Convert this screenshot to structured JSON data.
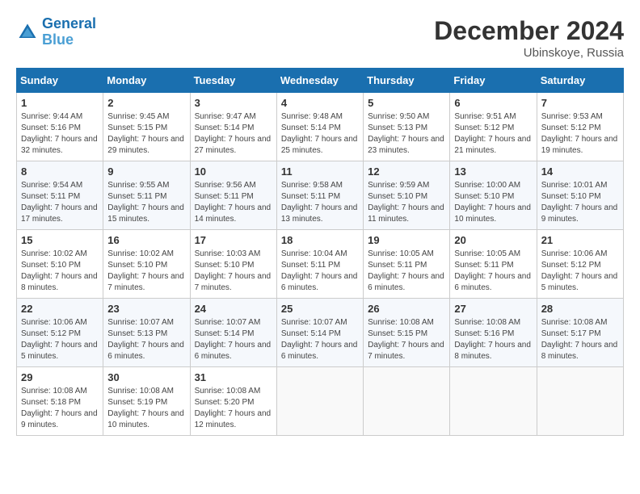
{
  "header": {
    "logo_line1": "General",
    "logo_line2": "Blue",
    "month_title": "December 2024",
    "subtitle": "Ubinskoye, Russia"
  },
  "weekdays": [
    "Sunday",
    "Monday",
    "Tuesday",
    "Wednesday",
    "Thursday",
    "Friday",
    "Saturday"
  ],
  "weeks": [
    [
      {
        "day": "1",
        "sunrise": "9:44 AM",
        "sunset": "5:16 PM",
        "daylight": "7 hours and 32 minutes."
      },
      {
        "day": "2",
        "sunrise": "9:45 AM",
        "sunset": "5:15 PM",
        "daylight": "7 hours and 29 minutes."
      },
      {
        "day": "3",
        "sunrise": "9:47 AM",
        "sunset": "5:14 PM",
        "daylight": "7 hours and 27 minutes."
      },
      {
        "day": "4",
        "sunrise": "9:48 AM",
        "sunset": "5:14 PM",
        "daylight": "7 hours and 25 minutes."
      },
      {
        "day": "5",
        "sunrise": "9:50 AM",
        "sunset": "5:13 PM",
        "daylight": "7 hours and 23 minutes."
      },
      {
        "day": "6",
        "sunrise": "9:51 AM",
        "sunset": "5:12 PM",
        "daylight": "7 hours and 21 minutes."
      },
      {
        "day": "7",
        "sunrise": "9:53 AM",
        "sunset": "5:12 PM",
        "daylight": "7 hours and 19 minutes."
      }
    ],
    [
      {
        "day": "8",
        "sunrise": "9:54 AM",
        "sunset": "5:11 PM",
        "daylight": "7 hours and 17 minutes."
      },
      {
        "day": "9",
        "sunrise": "9:55 AM",
        "sunset": "5:11 PM",
        "daylight": "7 hours and 15 minutes."
      },
      {
        "day": "10",
        "sunrise": "9:56 AM",
        "sunset": "5:11 PM",
        "daylight": "7 hours and 14 minutes."
      },
      {
        "day": "11",
        "sunrise": "9:58 AM",
        "sunset": "5:11 PM",
        "daylight": "7 hours and 13 minutes."
      },
      {
        "day": "12",
        "sunrise": "9:59 AM",
        "sunset": "5:10 PM",
        "daylight": "7 hours and 11 minutes."
      },
      {
        "day": "13",
        "sunrise": "10:00 AM",
        "sunset": "5:10 PM",
        "daylight": "7 hours and 10 minutes."
      },
      {
        "day": "14",
        "sunrise": "10:01 AM",
        "sunset": "5:10 PM",
        "daylight": "7 hours and 9 minutes."
      }
    ],
    [
      {
        "day": "15",
        "sunrise": "10:02 AM",
        "sunset": "5:10 PM",
        "daylight": "7 hours and 8 minutes."
      },
      {
        "day": "16",
        "sunrise": "10:02 AM",
        "sunset": "5:10 PM",
        "daylight": "7 hours and 7 minutes."
      },
      {
        "day": "17",
        "sunrise": "10:03 AM",
        "sunset": "5:10 PM",
        "daylight": "7 hours and 7 minutes."
      },
      {
        "day": "18",
        "sunrise": "10:04 AM",
        "sunset": "5:11 PM",
        "daylight": "7 hours and 6 minutes."
      },
      {
        "day": "19",
        "sunrise": "10:05 AM",
        "sunset": "5:11 PM",
        "daylight": "7 hours and 6 minutes."
      },
      {
        "day": "20",
        "sunrise": "10:05 AM",
        "sunset": "5:11 PM",
        "daylight": "7 hours and 6 minutes."
      },
      {
        "day": "21",
        "sunrise": "10:06 AM",
        "sunset": "5:12 PM",
        "daylight": "7 hours and 5 minutes."
      }
    ],
    [
      {
        "day": "22",
        "sunrise": "10:06 AM",
        "sunset": "5:12 PM",
        "daylight": "7 hours and 5 minutes."
      },
      {
        "day": "23",
        "sunrise": "10:07 AM",
        "sunset": "5:13 PM",
        "daylight": "7 hours and 6 minutes."
      },
      {
        "day": "24",
        "sunrise": "10:07 AM",
        "sunset": "5:14 PM",
        "daylight": "7 hours and 6 minutes."
      },
      {
        "day": "25",
        "sunrise": "10:07 AM",
        "sunset": "5:14 PM",
        "daylight": "7 hours and 6 minutes."
      },
      {
        "day": "26",
        "sunrise": "10:08 AM",
        "sunset": "5:15 PM",
        "daylight": "7 hours and 7 minutes."
      },
      {
        "day": "27",
        "sunrise": "10:08 AM",
        "sunset": "5:16 PM",
        "daylight": "7 hours and 8 minutes."
      },
      {
        "day": "28",
        "sunrise": "10:08 AM",
        "sunset": "5:17 PM",
        "daylight": "7 hours and 8 minutes."
      }
    ],
    [
      {
        "day": "29",
        "sunrise": "10:08 AM",
        "sunset": "5:18 PM",
        "daylight": "7 hours and 9 minutes."
      },
      {
        "day": "30",
        "sunrise": "10:08 AM",
        "sunset": "5:19 PM",
        "daylight": "7 hours and 10 minutes."
      },
      {
        "day": "31",
        "sunrise": "10:08 AM",
        "sunset": "5:20 PM",
        "daylight": "7 hours and 12 minutes."
      },
      null,
      null,
      null,
      null
    ]
  ]
}
